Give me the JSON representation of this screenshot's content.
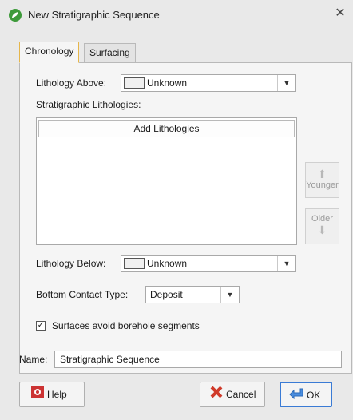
{
  "window": {
    "title": "New Stratigraphic Sequence",
    "close_glyph": "✕"
  },
  "tabs": [
    {
      "label": "Chronology",
      "active": true
    },
    {
      "label": "Surfacing",
      "active": false
    }
  ],
  "lithology_above": {
    "label": "Lithology Above:",
    "value": "Unknown",
    "swatch_color": "#f0f0f0"
  },
  "strat_lithologies": {
    "label": "Stratigraphic Lithologies:",
    "add_button": "Add Lithologies",
    "items": []
  },
  "side_buttons": {
    "younger": "Younger",
    "older": "Older"
  },
  "lithology_below": {
    "label": "Lithology Below:",
    "value": "Unknown",
    "swatch_color": "#f0f0f0"
  },
  "bottom_contact": {
    "label": "Bottom Contact Type:",
    "value": "Deposit"
  },
  "surfaces_avoid": {
    "label": "Surfaces avoid borehole segments",
    "checked": true
  },
  "name_field": {
    "label": "Name:",
    "value": "Stratigraphic Sequence"
  },
  "buttons": {
    "help": "Help",
    "cancel": "Cancel",
    "ok": "OK"
  },
  "colors": {
    "active_tab_border": "#e6b64a",
    "ok_border": "#3a7bd5",
    "app_icon": "#3d9a3a"
  }
}
